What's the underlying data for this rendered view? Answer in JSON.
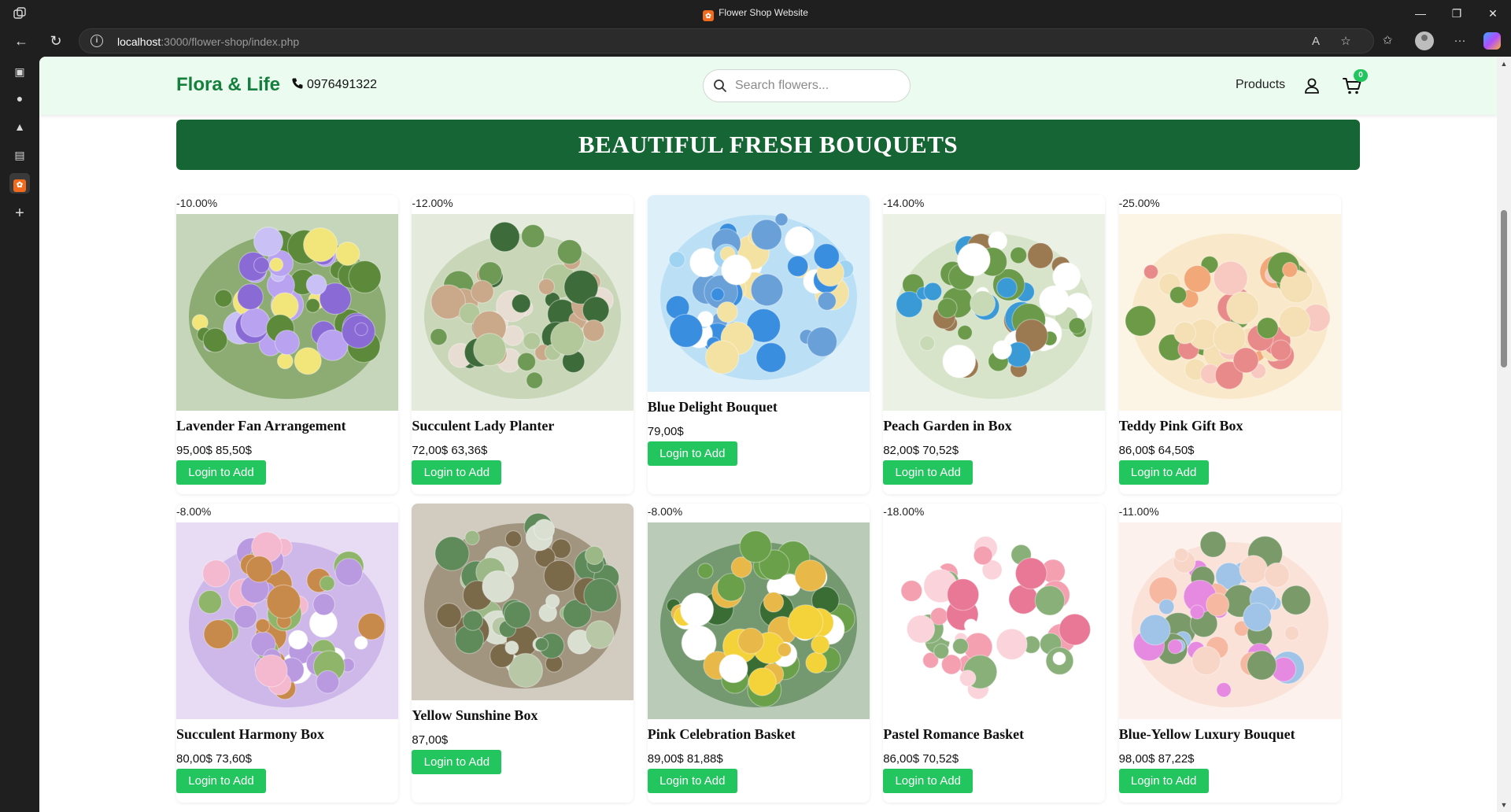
{
  "browser": {
    "tab_title": "Flower Shop Website",
    "url_host": "localhost",
    "url_path": ":3000/flower-shop/index.php"
  },
  "header": {
    "logo": "Flora & Life",
    "phone": "0976491322",
    "search_placeholder": "Search flowers...",
    "products_link": "Products",
    "cart_count": "0"
  },
  "banner": "BEAUTIFUL FRESH BOUQUETS",
  "colors": {
    "brand_green": "#15803d",
    "banner_green": "#166534",
    "button_green": "#22c55e",
    "header_bg": "#ecfbef"
  },
  "products": [
    {
      "discount": "-10.00%",
      "name": "Lavender Fan Arrangement",
      "price": "95,00$ 85,50$",
      "button": "Login to Add"
    },
    {
      "discount": "-12.00%",
      "name": "Succulent Lady Planter",
      "price": "72,00$ 63,36$",
      "button": "Login to Add"
    },
    {
      "discount": "",
      "name": "Blue Delight Bouquet",
      "price": "79,00$",
      "button": "Login to Add"
    },
    {
      "discount": "-14.00%",
      "name": "Peach Garden in Box",
      "price": "82,00$ 70,52$",
      "button": "Login to Add"
    },
    {
      "discount": "-25.00%",
      "name": "Teddy Pink Gift Box",
      "price": "86,00$ 64,50$",
      "button": "Login to Add"
    },
    {
      "discount": "-8.00%",
      "name": "Succulent Harmony Box",
      "price": "80,00$ 73,60$",
      "button": "Login to Add"
    },
    {
      "discount": "",
      "name": "Yellow Sunshine Box",
      "price": "87,00$",
      "button": "Login to Add"
    },
    {
      "discount": "-8.00%",
      "name": "Pink Celebration Basket",
      "price": "89,00$ 81,88$",
      "button": "Login to Add"
    },
    {
      "discount": "-18.00%",
      "name": "Pastel Romance Basket",
      "price": "86,00$ 70,52$",
      "button": "Login to Add"
    },
    {
      "discount": "-11.00%",
      "name": "Blue-Yellow Luxury Bouquet",
      "price": "98,00$ 87,22$",
      "button": "Login to Add"
    }
  ]
}
